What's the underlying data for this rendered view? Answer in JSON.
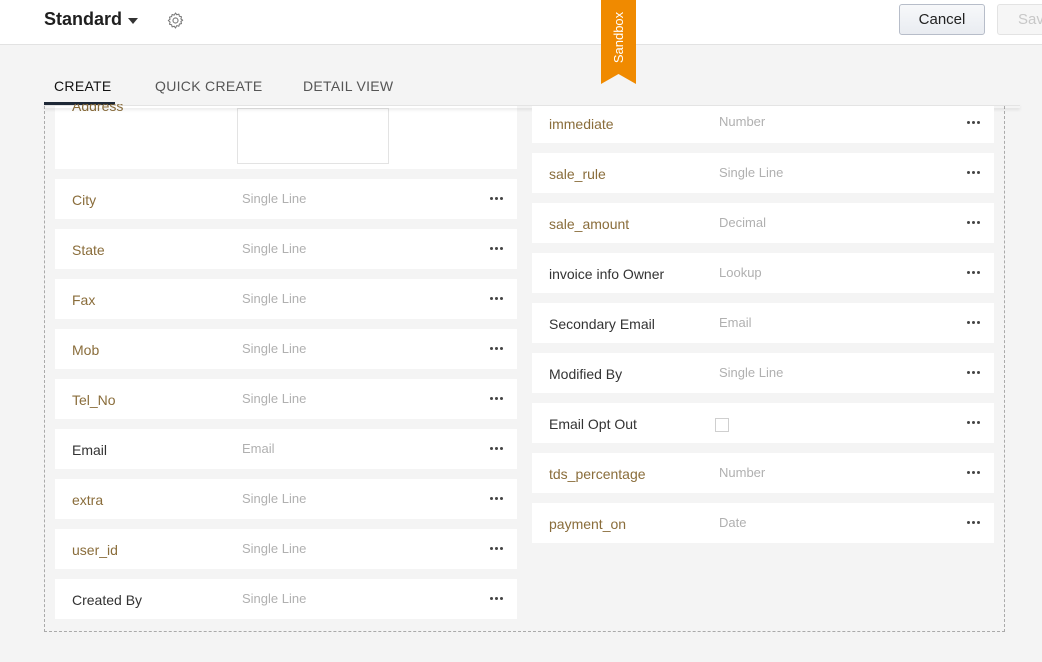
{
  "header": {
    "layout_name": "Standard",
    "cancel_label": "Cancel",
    "save_label": "Save",
    "sandbox_label": "Sandbox"
  },
  "tabs": [
    {
      "label": "CREATE",
      "active": true
    },
    {
      "label": "QUICK CREATE",
      "active": false
    },
    {
      "label": "DETAIL VIEW",
      "active": false
    }
  ],
  "colors": {
    "custom_field_label": "#8a6d3b",
    "standard_field_label": "#333333",
    "sandbox_ribbon": "#f08a00"
  },
  "left_fields": [
    {
      "label": "Address",
      "type": "",
      "custom": true
    },
    {
      "label": "City",
      "type": "Single Line",
      "custom": true
    },
    {
      "label": "State",
      "type": "Single Line",
      "custom": true
    },
    {
      "label": "Fax",
      "type": "Single Line",
      "custom": true
    },
    {
      "label": "Mob",
      "type": "Single Line",
      "custom": true
    },
    {
      "label": "Tel_No",
      "type": "Single Line",
      "custom": true
    },
    {
      "label": "Email",
      "type": "Email",
      "custom": false
    },
    {
      "label": "extra",
      "type": "Single Line",
      "custom": true
    },
    {
      "label": "user_id",
      "type": "Single Line",
      "custom": true
    },
    {
      "label": "Created By",
      "type": "Single Line",
      "custom": false
    }
  ],
  "right_fields": [
    {
      "label": "immediate",
      "type": "Number",
      "custom": true
    },
    {
      "label": "sale_rule",
      "type": "Single Line",
      "custom": true
    },
    {
      "label": "sale_amount",
      "type": "Decimal",
      "custom": true
    },
    {
      "label": "invoice info Owner",
      "type": "Lookup",
      "custom": false
    },
    {
      "label": "Secondary Email",
      "type": "Email",
      "custom": false
    },
    {
      "label": "Modified By",
      "type": "Single Line",
      "custom": false
    },
    {
      "label": "Email Opt Out",
      "type": "checkbox",
      "custom": false
    },
    {
      "label": "tds_percentage",
      "type": "Number",
      "custom": true
    },
    {
      "label": "payment_on",
      "type": "Date",
      "custom": true
    }
  ]
}
